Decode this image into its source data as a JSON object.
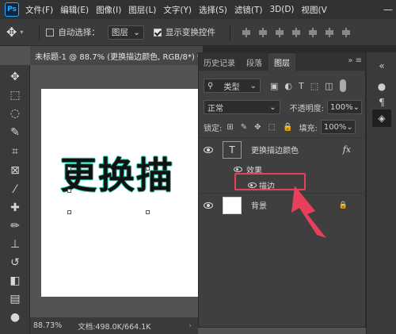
{
  "app": {
    "logo": "Ps"
  },
  "menubar": {
    "items": [
      "文件(F)",
      "编辑(E)",
      "图像(I)",
      "图层(L)",
      "文字(Y)",
      "选择(S)",
      "滤镜(T)",
      "3D(D)",
      "视图(V"
    ]
  },
  "options_bar": {
    "auto_select_label": "自动选择：",
    "auto_select_checked": false,
    "auto_select_target": "图层",
    "show_transform_label": "显示变换控件",
    "show_transform_checked": true
  },
  "document": {
    "tab_title": "未标题-1 @ 88.7% (更换描边颜色, RGB/8*) *",
    "canvas_text": "更换描"
  },
  "statusbar": {
    "zoom": "88.73%",
    "doc_info": "文档:498.0K/664.1K"
  },
  "panel": {
    "tabs": [
      "历史记录",
      "段落",
      "图层"
    ],
    "active_tab": "图层",
    "filter_label": "类型",
    "blend_mode": "正常",
    "opacity_label": "不透明度:",
    "opacity_value": "100%",
    "lock_label": "锁定:",
    "fill_label": "填充:",
    "fill_value": "100%",
    "layers": [
      {
        "name": "更换描边颜色",
        "type": "text",
        "thumb_glyph": "T",
        "has_fx": true,
        "fx_label": "fx"
      },
      {
        "name": "背景",
        "type": "background",
        "locked": true
      }
    ],
    "effects_label": "效果",
    "effect_items": [
      "描边"
    ]
  },
  "colors": {
    "accent_highlight": "#e8405c",
    "stroke_color": "#2ad0b4"
  }
}
